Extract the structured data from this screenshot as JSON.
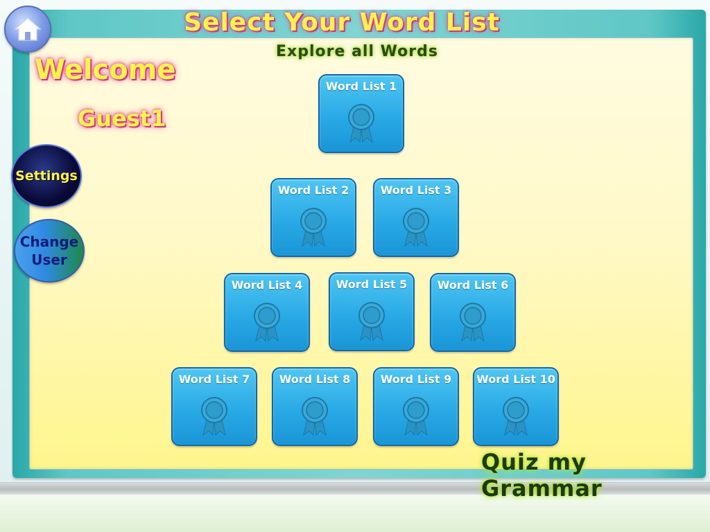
{
  "header": {
    "title": "Select Your Word List",
    "subtitle": "Explore all Words"
  },
  "user": {
    "welcome": "Welcome",
    "name": "Guest1"
  },
  "sidebar": {
    "home_icon": "home-icon",
    "settings_label": "Settings",
    "change_user_line1": "Change",
    "change_user_line2": "User"
  },
  "word_lists": [
    {
      "label": "Word List 1"
    },
    {
      "label": "Word List 2"
    },
    {
      "label": "Word List 3"
    },
    {
      "label": "Word List 4"
    },
    {
      "label": "Word List 5"
    },
    {
      "label": "Word List 6"
    },
    {
      "label": "Word List 7"
    },
    {
      "label": "Word List 8"
    },
    {
      "label": "Word List 9"
    },
    {
      "label": "Word List 10"
    }
  ],
  "footer": {
    "brand": "Quiz my Grammar"
  },
  "colors": {
    "tile": "#29a9e6",
    "title_yellow": "#fff34a",
    "board_teal": "#5fc7c6"
  }
}
